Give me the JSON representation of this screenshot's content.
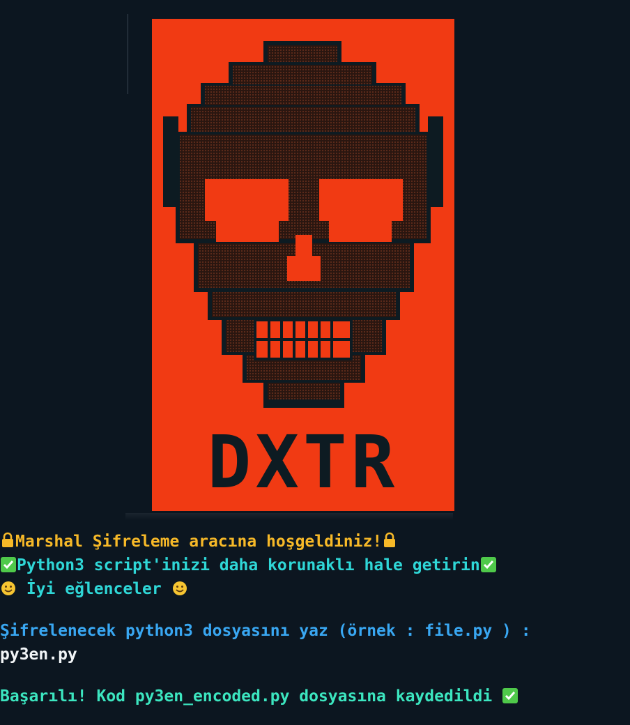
{
  "banner": {
    "label": "DXTR",
    "background": "#f13a13",
    "ink": "#0d1b22"
  },
  "output": {
    "welcome": "Marshal Şifreleme aracına hoşgeldiniz!",
    "protect": "Python3 script'inizi daha korunaklı hale getirin",
    "fun": " İyi eğlenceler ",
    "prompt": "Şifrelenecek python3 dosyasını yaz (örnek : file.py ) :",
    "input_value": "py3en.py",
    "result": "Başarılı! Kod py3en_encoded.py dosyasına kaydedildi "
  },
  "icons": {
    "lock": "lock-icon",
    "check": "check-mark-icon",
    "smile": "smiling-face-icon"
  },
  "colors": {
    "background": "#0c1620",
    "welcome_text": "#f7b928",
    "info_text": "#2fd7d7",
    "prompt_text": "#39a7f2",
    "input_text": "#f2f5f7",
    "success_text": "#3ce6c0"
  }
}
